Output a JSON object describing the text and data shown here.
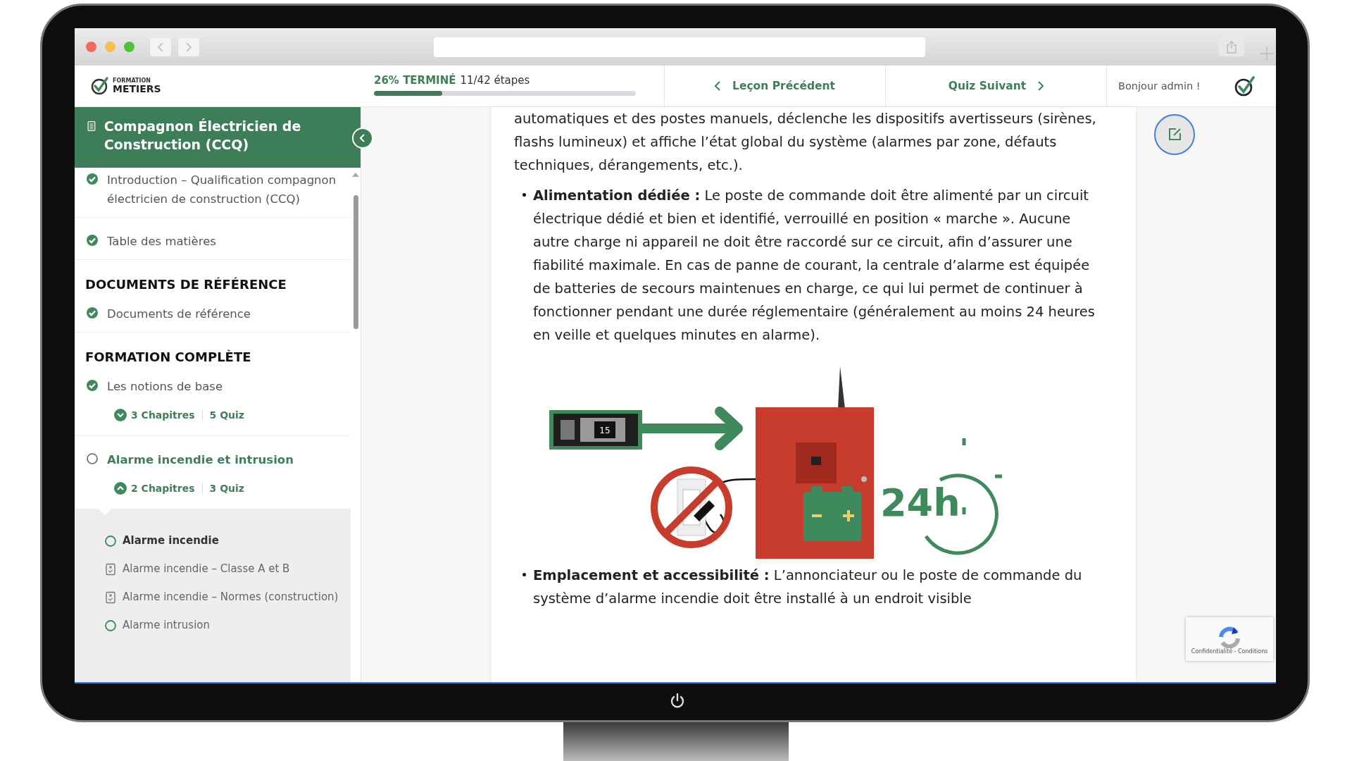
{
  "header": {
    "logo": {
      "small": "FORMATION",
      "main": "METIERS"
    },
    "progress": {
      "percent": "26% TERMINÉ",
      "steps": "11/42 étapes",
      "level": 0.26
    },
    "prev": "Leçon Précédent",
    "next": "Quiz Suivant",
    "greeting": "Bonjour admin !"
  },
  "sidebar": {
    "title": "Compagnon Électricien de Construction (CCQ)",
    "sections": [
      {
        "items": [
          {
            "label": "Introduction – Qualification compagnon électricien de construction (CCQ)",
            "completed": true,
            "current": false
          },
          {
            "label": "Table des matières",
            "completed": true,
            "current": false
          }
        ]
      },
      {
        "heading": "DOCUMENTS DE RÉFÉRENCE",
        "items": [
          {
            "label": "Documents de référence",
            "completed": true,
            "current": false
          }
        ]
      },
      {
        "heading": "FORMATION COMPLÈTE",
        "items": [
          {
            "label": "Les notions de base",
            "completed": true,
            "current": false,
            "chapters": "3 Chapitres",
            "quizzes": "5 Quiz",
            "expanded": false
          },
          {
            "label": "Alarme incendie et intrusion",
            "completed": false,
            "current": true,
            "chapters": "2 Chapitres",
            "quizzes": "3 Quiz",
            "expanded": true,
            "children": [
              {
                "kind": "chapter",
                "label": "Alarme incendie",
                "current": true
              },
              {
                "kind": "quiz",
                "label": "Alarme incendie – Classe A et B",
                "current": false
              },
              {
                "kind": "quiz",
                "label": "Alarme incendie – Normes (construction)",
                "current": false
              },
              {
                "kind": "chapter",
                "label": "Alarme intrusion",
                "current": false
              }
            ]
          }
        ]
      }
    ]
  },
  "article": {
    "blocks": [
      {
        "kind": "text",
        "text": "automatiques et des postes manuels, déclenche les dispositifs avertisseurs (sirènes, flashs lumineux) et affiche l’état global du système (alarmes par zone, défauts techniques, dérangements, etc.)."
      },
      {
        "kind": "bullet",
        "text": "**Alimentation dédiée :** Le poste de commande doit être alimenté par un circuit électrique dédié et bien et identifié, verrouillé en position « marche ». Aucune autre charge ni appareil ne doit être raccordé sur ce circuit, afin d’assurer une fiabilité maximale. En cas de panne de courant, la centrale d’alarme est équipée de batteries de secours maintenues en charge, ce qui lui permet de continuer à fonctionner pendant une durée réglementaire (généralement au moins 24 heures en veille et quelques minutes en alarme)."
      },
      {
        "kind": "figure",
        "breaker_rating": "15",
        "duration": "24h"
      },
      {
        "kind": "bullet",
        "text": "**Emplacement et accessibilité :** L’annonciateur ou le poste de commande du système d’alarme incendie doit être installé à un endroit visible"
      }
    ]
  },
  "recaptcha": {
    "text": "Confidentialité - Conditions"
  }
}
